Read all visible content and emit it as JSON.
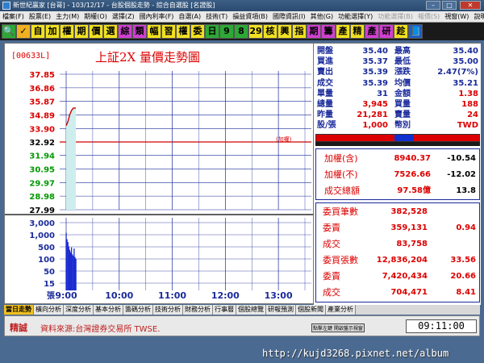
{
  "window": {
    "title": "新世紀贏家 [台哥] - 103/12/17 - 台股個股走勢 - 綜合自選股 [名證股]"
  },
  "menu": {
    "items": [
      "檔案(F)",
      "股票(E)",
      "主力(M)",
      "期權(O)",
      "選擇(Z)",
      "國內利率(F)",
      "自選(A)",
      "技術(T)",
      "損益資項(B)",
      "國際資訊(I)",
      "其他(G)",
      "功能選擇(Y)"
    ],
    "dim_items": [
      "功能選擇(B)",
      "報價(S)"
    ],
    "right_items": [
      "視窗(W)",
      "說明(H)"
    ]
  },
  "toolbar": {
    "buttons": [
      {
        "label": "🔍",
        "bg": "#2da836"
      },
      {
        "label": "✓",
        "bg": "#f0b020"
      },
      {
        "label": "自",
        "bg": "#f0e020"
      },
      {
        "label": "加",
        "bg": "#f0e020"
      },
      {
        "label": "權",
        "bg": "#f0e020"
      },
      {
        "label": "期",
        "bg": "#f0e020"
      },
      {
        "label": "價",
        "bg": "#f0e020"
      },
      {
        "label": "選",
        "bg": "#f0e020"
      },
      {
        "label": "綜",
        "bg": "#d040d0"
      },
      {
        "label": "類",
        "bg": "#d040d0"
      },
      {
        "label": "幅",
        "bg": "#f0e020"
      },
      {
        "label": "習",
        "bg": "#f0e020"
      },
      {
        "label": "權",
        "bg": "#f0e020"
      },
      {
        "label": "委",
        "bg": "#f0e020"
      },
      {
        "label": "日",
        "bg": "#2da836"
      },
      {
        "label": "9",
        "bg": "#2da836"
      },
      {
        "label": "8",
        "bg": "#2da836"
      },
      {
        "label": "29",
        "bg": "#f0e020"
      },
      {
        "label": "核",
        "bg": "#f0e020"
      },
      {
        "label": "興",
        "bg": "#f0e020"
      },
      {
        "label": "指",
        "bg": "#f0e020"
      },
      {
        "label": "期",
        "bg": "#d040d0"
      },
      {
        "label": "籌",
        "bg": "#d040d0"
      },
      {
        "label": "產",
        "bg": "#f0e020"
      },
      {
        "label": "精",
        "bg": "#f0e020"
      },
      {
        "label": "產",
        "bg": "#d040d0"
      },
      {
        "label": "研",
        "bg": "#d040d0"
      },
      {
        "label": "趁",
        "bg": "#f0e020"
      },
      {
        "label": "📘",
        "bg": "#2060c0"
      }
    ]
  },
  "chart_data": {
    "type": "line",
    "ticker": "[00633L]",
    "title": "上証2X  量價走勢圖",
    "reference_label": "(加權)",
    "price_axis": {
      "ticks": [
        "37.85",
        "36.86",
        "35.87",
        "34.89",
        "33.90",
        "32.92",
        "31.94",
        "30.95",
        "29.97",
        "28.98",
        "27.99"
      ],
      "ylim": [
        27.99,
        37.85
      ],
      "reference": 32.92
    },
    "volume_axis": {
      "ticks": [
        "3,000",
        "1,000",
        "500",
        "100",
        "50",
        "15",
        "張"
      ]
    },
    "x_ticks": [
      "9:00",
      "10:00",
      "11:00",
      "12:00",
      "13:00"
    ],
    "price_series": {
      "x": [
        "9:00",
        "9:02",
        "9:04",
        "9:06",
        "9:08",
        "9:10",
        "9:11"
      ],
      "y": [
        34.1,
        34.4,
        34.9,
        35.2,
        35.38,
        35.39,
        35.39
      ]
    },
    "volume_series": {
      "x": [
        "9:00",
        "9:01",
        "9:02",
        "9:03",
        "9:04",
        "9:05",
        "9:06",
        "9:07",
        "9:08",
        "9:09",
        "9:10",
        "9:11"
      ],
      "y": [
        900,
        420,
        300,
        180,
        120,
        90,
        160,
        70,
        60,
        140,
        50,
        40
      ]
    }
  },
  "quote": {
    "rows": [
      {
        "l1": "開盤",
        "v1": "35.40",
        "c1": "blue",
        "l2": "最高",
        "v2": "35.40",
        "c2": "blue"
      },
      {
        "l1": "買進",
        "v1": "35.37",
        "c1": "blue",
        "l2": "最低",
        "v2": "35.00",
        "c2": "blue"
      },
      {
        "l1": "賣出",
        "v1": "35.39",
        "c1": "blue",
        "l2": "漲跌",
        "v2": "2.47(7%)",
        "c2": "blue"
      },
      {
        "l1": "成交",
        "v1": "35.39",
        "c1": "blue",
        "l2": "均價",
        "v2": "35.21",
        "c2": "blue"
      },
      {
        "l1": "單量",
        "v1": "31",
        "c1": "blue",
        "l2": "金額",
        "v2": "1.38",
        "c2": "red"
      },
      {
        "l1": "總量",
        "v1": "3,945",
        "c1": "red",
        "l2": "買量",
        "v2": "188",
        "c2": "red"
      },
      {
        "l1": "昨量",
        "v1": "21,281",
        "c1": "red",
        "l2": "賣量",
        "v2": "24",
        "c2": "red"
      },
      {
        "l1": "股/張",
        "v1": "1,000",
        "c1": "red",
        "l2": "幣別",
        "v2": "TWD",
        "c2": "red"
      }
    ],
    "index_rows": [
      {
        "label": "加權(含)",
        "value": "8940.37",
        "change": "-10.54"
      },
      {
        "label": "加權(不)",
        "value": "7526.66",
        "change": "-12.02"
      },
      {
        "label": "成交總額",
        "value": "97.58億",
        "change": "13.8"
      }
    ],
    "order_rows": [
      {
        "label": "委買筆數",
        "value": "382,528",
        "extra": ""
      },
      {
        "label": "委賣",
        "value": "359,131",
        "extra": "0.94"
      },
      {
        "label": "成交",
        "value": "83,758",
        "extra": ""
      },
      {
        "label": "委買張數",
        "value": "12,836,204",
        "extra": "33.56"
      },
      {
        "label": "委賣",
        "value": "7,420,434",
        "extra": "20.66"
      },
      {
        "label": "成交",
        "value": "704,471",
        "extra": "8.41"
      }
    ]
  },
  "tabs": [
    "當日走勢",
    "橫向分析",
    "深度分析",
    "基本分析",
    "籌碼分析",
    "技術分析",
    "財務分析",
    "行事曆",
    "個股總覽",
    "研報預測",
    "個股新聞",
    "產業分析"
  ],
  "status": {
    "brand": "精誠",
    "source": "資料來源:台灣證券交易所 TWSE.",
    "tip": "點擊左鍵 開啟盤示視窗",
    "time": "09:11:00"
  },
  "watermark": "http://kujd3268.pixnet.net/album",
  "colors": {
    "grid_blue": "#1a2a9a",
    "reference_red": "#d00000",
    "price_line": "#d00000",
    "volume_bar": "#1a2ad0",
    "area_fill": "#cdeeed"
  }
}
